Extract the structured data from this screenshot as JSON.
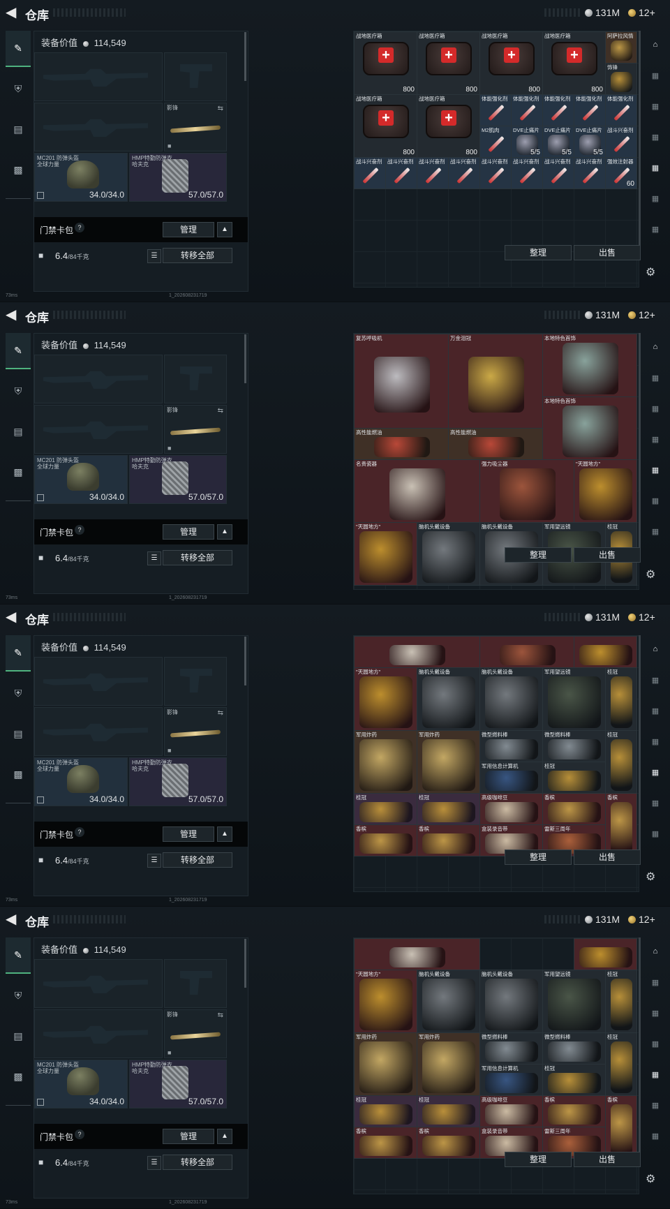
{
  "header": {
    "title": "仓库",
    "currency_silver": "131M",
    "currency_gold": "12+"
  },
  "loadout": {
    "value_label": "装备价值",
    "value": "114,549",
    "melee_label": "影锋",
    "helmet_name": "MC201 防弹头盔",
    "helmet_sub": "全球力量",
    "helmet_durability": "34.0/34.0",
    "vest_name": "HMP特勤防弹衣",
    "vest_sub": "哈夫克",
    "vest_durability": "57.0/57.0",
    "card_pack_label": "门禁卡包",
    "manage_label": "管理",
    "weight": "6.4",
    "weight_capacity": "/84千克",
    "transfer_all_label": "转移全部"
  },
  "stash": {
    "sort_label": "整理",
    "sell_label": "出售"
  },
  "footer": {
    "ping": "73ms",
    "build": "1_202608231719"
  },
  "panels": [
    {
      "items": [
        {
          "name": "战地医疗箱",
          "count": "800",
          "kind": "medkit",
          "color": "c-dark",
          "c": 0,
          "r": 0,
          "w": 2,
          "h": 2
        },
        {
          "name": "战地医疗箱",
          "count": "800",
          "kind": "medkit",
          "color": "c-dark",
          "c": 2,
          "r": 0,
          "w": 2,
          "h": 2
        },
        {
          "name": "战地医疗箱",
          "count": "800",
          "kind": "medkit",
          "color": "c-dark",
          "c": 4,
          "r": 0,
          "w": 2,
          "h": 2
        },
        {
          "name": "战地医疗箱",
          "count": "800",
          "kind": "medkit",
          "color": "c-dark",
          "c": 6,
          "r": 0,
          "w": 2,
          "h": 2
        },
        {
          "name": "阿萨拉风情",
          "count": "",
          "kind": "bottle",
          "color": "c-brown",
          "c": 8,
          "r": 0,
          "w": 1,
          "h": 1
        },
        {
          "name": "饰锋",
          "count": "",
          "kind": "gold",
          "color": "c-dark",
          "c": 8,
          "r": 1,
          "w": 1,
          "h": 1
        },
        {
          "name": "战地医疗箱",
          "count": "800",
          "kind": "medkit",
          "color": "c-dark",
          "c": 0,
          "r": 2,
          "w": 2,
          "h": 2
        },
        {
          "name": "战地医疗箱",
          "count": "800",
          "kind": "medkit",
          "color": "c-dark",
          "c": 2,
          "r": 2,
          "w": 2,
          "h": 2
        },
        {
          "name": "体能强化剂",
          "count": "",
          "kind": "syringe",
          "color": "c-blue",
          "c": 4,
          "r": 2,
          "w": 1,
          "h": 1
        },
        {
          "name": "体能强化剂",
          "count": "",
          "kind": "syringe",
          "color": "c-blue",
          "c": 5,
          "r": 2,
          "w": 1,
          "h": 1
        },
        {
          "name": "体能强化剂",
          "count": "",
          "kind": "syringe",
          "color": "c-blue",
          "c": 6,
          "r": 2,
          "w": 1,
          "h": 1
        },
        {
          "name": "体能强化剂",
          "count": "",
          "kind": "syringe",
          "color": "c-blue",
          "c": 7,
          "r": 2,
          "w": 1,
          "h": 1
        },
        {
          "name": "体能强化剂",
          "count": "",
          "kind": "syringe",
          "color": "c-blue",
          "c": 8,
          "r": 2,
          "w": 1,
          "h": 1
        },
        {
          "name": "M2肌肉",
          "count": "",
          "kind": "syringe",
          "color": "c-blue",
          "c": 4,
          "r": 3,
          "w": 1,
          "h": 1
        },
        {
          "name": "DVE止痛片",
          "count": "5/5",
          "kind": "tube",
          "color": "c-blue",
          "c": 5,
          "r": 3,
          "w": 1,
          "h": 1
        },
        {
          "name": "DVE止痛片",
          "count": "5/5",
          "kind": "tube",
          "color": "c-blue",
          "c": 6,
          "r": 3,
          "w": 1,
          "h": 1
        },
        {
          "name": "DVE止痛片",
          "count": "5/5",
          "kind": "tube",
          "color": "c-blue",
          "c": 7,
          "r": 3,
          "w": 1,
          "h": 1
        },
        {
          "name": "战斗兴奋剂",
          "count": "",
          "kind": "syringe",
          "color": "c-blue",
          "c": 8,
          "r": 3,
          "w": 1,
          "h": 1
        },
        {
          "name": "战斗兴奋剂",
          "count": "",
          "kind": "syringe",
          "color": "c-blue",
          "c": 0,
          "r": 4,
          "w": 1,
          "h": 1
        },
        {
          "name": "战斗兴奋剂",
          "count": "",
          "kind": "syringe",
          "color": "c-blue",
          "c": 1,
          "r": 4,
          "w": 1,
          "h": 1
        },
        {
          "name": "战斗兴奋剂",
          "count": "",
          "kind": "syringe",
          "color": "c-blue",
          "c": 2,
          "r": 4,
          "w": 1,
          "h": 1
        },
        {
          "name": "战斗兴奋剂",
          "count": "",
          "kind": "syringe",
          "color": "c-blue",
          "c": 3,
          "r": 4,
          "w": 1,
          "h": 1
        },
        {
          "name": "战斗兴奋剂",
          "count": "",
          "kind": "syringe",
          "color": "c-blue",
          "c": 4,
          "r": 4,
          "w": 1,
          "h": 1
        },
        {
          "name": "战斗兴奋剂",
          "count": "",
          "kind": "syringe",
          "color": "c-blue",
          "c": 5,
          "r": 4,
          "w": 1,
          "h": 1
        },
        {
          "name": "战斗兴奋剂",
          "count": "",
          "kind": "syringe",
          "color": "c-blue",
          "c": 6,
          "r": 4,
          "w": 1,
          "h": 1
        },
        {
          "name": "战斗兴奋剂",
          "count": "",
          "kind": "syringe",
          "color": "c-blue",
          "c": 7,
          "r": 4,
          "w": 1,
          "h": 1
        },
        {
          "name": "强效注射器",
          "count": "60",
          "kind": "syringe",
          "color": "c-blue",
          "c": 8,
          "r": 4,
          "w": 1,
          "h": 1
        }
      ]
    },
    {
      "items": [
        {
          "name": "复苏呼吸机",
          "count": "",
          "kind": "machine",
          "color": "c-red",
          "c": 0,
          "r": 0,
          "w": 3,
          "h": 3
        },
        {
          "name": "万金泪冠",
          "count": "",
          "kind": "egg",
          "color": "c-red",
          "c": 3,
          "r": 0,
          "w": 3,
          "h": 3
        },
        {
          "name": "本地特色首饰",
          "count": "",
          "kind": "jewel",
          "color": "c-red",
          "c": 6,
          "r": 0,
          "w": 3,
          "h": 2
        },
        {
          "name": "本地特色首饰",
          "count": "",
          "kind": "jewel",
          "color": "c-red",
          "c": 6,
          "r": 2,
          "w": 3,
          "h": 2
        },
        {
          "name": "高性能燃油",
          "count": "",
          "kind": "brick",
          "color": "c-brown",
          "c": 0,
          "r": 3,
          "w": 3,
          "h": 1
        },
        {
          "name": "高性能燃油",
          "count": "",
          "kind": "brick",
          "color": "c-brown",
          "c": 3,
          "r": 3,
          "w": 3,
          "h": 1
        },
        {
          "name": "名贵瓷器",
          "count": "",
          "kind": "vase",
          "color": "c-red",
          "c": 0,
          "r": 4,
          "w": 4,
          "h": 2
        },
        {
          "name": "强力吸尘器",
          "count": "",
          "kind": "tool",
          "color": "c-red",
          "c": 4,
          "r": 4,
          "w": 3,
          "h": 2
        },
        {
          "name": "\"天圆地方\"",
          "count": "",
          "kind": "globe",
          "color": "c-red",
          "c": 7,
          "r": 4,
          "w": 2,
          "h": 2
        },
        {
          "name": "\"天圆地方\"",
          "count": "",
          "kind": "globe",
          "color": "c-red",
          "c": 0,
          "r": 6,
          "w": 2,
          "h": 2
        },
        {
          "name": "脑机头戴设备",
          "count": "",
          "kind": "headset",
          "color": "c-dark",
          "c": 2,
          "r": 6,
          "w": 2,
          "h": 2
        },
        {
          "name": "脑机头戴设备",
          "count": "",
          "kind": "headset",
          "color": "c-dark",
          "c": 4,
          "r": 6,
          "w": 2,
          "h": 2
        },
        {
          "name": "军用望远镜",
          "count": "",
          "kind": "binoc",
          "color": "c-dark",
          "c": 6,
          "r": 6,
          "w": 2,
          "h": 2
        },
        {
          "name": "桂冠",
          "count": "",
          "kind": "gold",
          "color": "c-dark",
          "c": 8,
          "r": 6,
          "w": 1,
          "h": 2
        }
      ]
    },
    {
      "items": [
        {
          "name": "",
          "count": "",
          "kind": "vase",
          "color": "c-red",
          "c": 0,
          "r": 0,
          "w": 4,
          "h": 1
        },
        {
          "name": "",
          "count": "",
          "kind": "tool",
          "color": "c-red",
          "c": 4,
          "r": 0,
          "w": 3,
          "h": 1
        },
        {
          "name": "",
          "count": "",
          "kind": "globe",
          "color": "c-red",
          "c": 7,
          "r": 0,
          "w": 2,
          "h": 1
        },
        {
          "name": "\"天圆地方\"",
          "count": "",
          "kind": "globe",
          "color": "c-red",
          "c": 0,
          "r": 1,
          "w": 2,
          "h": 2
        },
        {
          "name": "脑机头戴设备",
          "count": "",
          "kind": "headset",
          "color": "c-dark",
          "c": 2,
          "r": 1,
          "w": 2,
          "h": 2
        },
        {
          "name": "脑机头戴设备",
          "count": "",
          "kind": "headset",
          "color": "c-dark",
          "c": 4,
          "r": 1,
          "w": 2,
          "h": 2
        },
        {
          "name": "军用望远镜",
          "count": "",
          "kind": "binoc",
          "color": "c-dark",
          "c": 6,
          "r": 1,
          "w": 2,
          "h": 2
        },
        {
          "name": "桂冠",
          "count": "",
          "kind": "gold",
          "color": "c-dark",
          "c": 8,
          "r": 1,
          "w": 1,
          "h": 2
        },
        {
          "name": "军用炸药",
          "count": "",
          "kind": "crate",
          "color": "c-brown",
          "c": 0,
          "r": 3,
          "w": 2,
          "h": 2
        },
        {
          "name": "军用炸药",
          "count": "",
          "kind": "crate",
          "color": "c-brown",
          "c": 2,
          "r": 3,
          "w": 2,
          "h": 2
        },
        {
          "name": "微型燃料棒",
          "count": "",
          "kind": "rods",
          "color": "c-dark",
          "c": 4,
          "r": 3,
          "w": 2,
          "h": 1
        },
        {
          "name": "微型燃料棒",
          "count": "",
          "kind": "rods",
          "color": "c-dark",
          "c": 6,
          "r": 3,
          "w": 2,
          "h": 1
        },
        {
          "name": "桂冠",
          "count": "",
          "kind": "gold",
          "color": "c-dark",
          "c": 8,
          "r": 3,
          "w": 1,
          "h": 2
        },
        {
          "name": "军用信息计算机",
          "count": "",
          "kind": "device",
          "color": "c-dark",
          "c": 4,
          "r": 4,
          "w": 2,
          "h": 1
        },
        {
          "name": "桂冠",
          "count": "",
          "kind": "gold",
          "color": "c-dark",
          "c": 6,
          "r": 4,
          "w": 2,
          "h": 1
        },
        {
          "name": "桂冠",
          "count": "",
          "kind": "gold",
          "color": "c-purple",
          "c": 0,
          "r": 5,
          "w": 2,
          "h": 1
        },
        {
          "name": "桂冠",
          "count": "",
          "kind": "gold",
          "color": "c-purple",
          "c": 2,
          "r": 5,
          "w": 2,
          "h": 1
        },
        {
          "name": "高级咖啡豆",
          "count": "",
          "kind": "box",
          "color": "c-red",
          "c": 4,
          "r": 5,
          "w": 2,
          "h": 1
        },
        {
          "name": "香槟",
          "count": "",
          "kind": "bottle",
          "color": "c-red",
          "c": 6,
          "r": 5,
          "w": 2,
          "h": 1
        },
        {
          "name": "香槟",
          "count": "",
          "kind": "bottle",
          "color": "c-red",
          "c": 8,
          "r": 5,
          "w": 1,
          "h": 2
        },
        {
          "name": "香槟",
          "count": "",
          "kind": "bottle",
          "color": "c-red",
          "c": 0,
          "r": 6,
          "w": 2,
          "h": 1
        },
        {
          "name": "香槟",
          "count": "",
          "kind": "bottle",
          "color": "c-red",
          "c": 2,
          "r": 6,
          "w": 2,
          "h": 1
        },
        {
          "name": "盒装录音带",
          "count": "",
          "kind": "box",
          "color": "c-red",
          "c": 4,
          "r": 6,
          "w": 2,
          "h": 1
        },
        {
          "name": "雷斯三周年",
          "count": "",
          "kind": "book",
          "color": "c-red",
          "c": 6,
          "r": 6,
          "w": 2,
          "h": 1
        }
      ]
    },
    {
      "items": [
        {
          "name": "",
          "count": "",
          "kind": "vase",
          "color": "c-red",
          "c": 0,
          "r": 0,
          "w": 4,
          "h": 1
        },
        {
          "name": "",
          "count": "",
          "kind": "globe",
          "color": "c-red",
          "c": 7,
          "r": 0,
          "w": 2,
          "h": 1
        },
        {
          "name": "\"天圆地方\"",
          "count": "",
          "kind": "globe",
          "color": "c-red",
          "c": 0,
          "r": 1,
          "w": 2,
          "h": 2
        },
        {
          "name": "脑机头戴设备",
          "count": "",
          "kind": "headset",
          "color": "c-dark",
          "c": 2,
          "r": 1,
          "w": 2,
          "h": 2
        },
        {
          "name": "脑机头戴设备",
          "count": "",
          "kind": "headset",
          "color": "c-dark",
          "c": 4,
          "r": 1,
          "w": 2,
          "h": 2
        },
        {
          "name": "军用望远镜",
          "count": "",
          "kind": "binoc",
          "color": "c-dark",
          "c": 6,
          "r": 1,
          "w": 2,
          "h": 2
        },
        {
          "name": "桂冠",
          "count": "",
          "kind": "gold",
          "color": "c-dark",
          "c": 8,
          "r": 1,
          "w": 1,
          "h": 2
        },
        {
          "name": "军用炸药",
          "count": "",
          "kind": "crate",
          "color": "c-brown",
          "c": 0,
          "r": 3,
          "w": 2,
          "h": 2
        },
        {
          "name": "军用炸药",
          "count": "",
          "kind": "crate",
          "color": "c-brown",
          "c": 2,
          "r": 3,
          "w": 2,
          "h": 2
        },
        {
          "name": "微型燃料棒",
          "count": "",
          "kind": "rods",
          "color": "c-dark",
          "c": 4,
          "r": 3,
          "w": 2,
          "h": 1
        },
        {
          "name": "微型燃料棒",
          "count": "",
          "kind": "rods",
          "color": "c-dark",
          "c": 6,
          "r": 3,
          "w": 2,
          "h": 1
        },
        {
          "name": "桂冠",
          "count": "",
          "kind": "gold",
          "color": "c-dark",
          "c": 8,
          "r": 3,
          "w": 1,
          "h": 2
        },
        {
          "name": "军用信息计算机",
          "count": "",
          "kind": "device",
          "color": "c-dark",
          "c": 4,
          "r": 4,
          "w": 2,
          "h": 1
        },
        {
          "name": "桂冠",
          "count": "",
          "kind": "gold",
          "color": "c-dark",
          "c": 6,
          "r": 4,
          "w": 2,
          "h": 1
        },
        {
          "name": "桂冠",
          "count": "",
          "kind": "gold",
          "color": "c-purple",
          "c": 0,
          "r": 5,
          "w": 2,
          "h": 1
        },
        {
          "name": "桂冠",
          "count": "",
          "kind": "gold",
          "color": "c-purple",
          "c": 2,
          "r": 5,
          "w": 2,
          "h": 1
        },
        {
          "name": "高级咖啡豆",
          "count": "",
          "kind": "box",
          "color": "c-red",
          "c": 4,
          "r": 5,
          "w": 2,
          "h": 1
        },
        {
          "name": "香槟",
          "count": "",
          "kind": "bottle",
          "color": "c-red",
          "c": 6,
          "r": 5,
          "w": 2,
          "h": 1
        },
        {
          "name": "香槟",
          "count": "",
          "kind": "bottle",
          "color": "c-red",
          "c": 8,
          "r": 5,
          "w": 1,
          "h": 2
        },
        {
          "name": "香槟",
          "count": "",
          "kind": "bottle",
          "color": "c-red",
          "c": 0,
          "r": 6,
          "w": 2,
          "h": 1
        },
        {
          "name": "香槟",
          "count": "",
          "kind": "bottle",
          "color": "c-red",
          "c": 2,
          "r": 6,
          "w": 2,
          "h": 1
        },
        {
          "name": "盒装录音带",
          "count": "",
          "kind": "box",
          "color": "c-red",
          "c": 4,
          "r": 6,
          "w": 2,
          "h": 1
        },
        {
          "name": "雷斯三周年",
          "count": "",
          "kind": "book",
          "color": "c-red",
          "c": 6,
          "r": 6,
          "w": 2,
          "h": 1
        }
      ]
    }
  ],
  "colors": {
    "accent_green": "#4fb37f",
    "bg": "#0d1318",
    "rarity_red": "#4a2428",
    "rarity_blue": "#253444"
  }
}
